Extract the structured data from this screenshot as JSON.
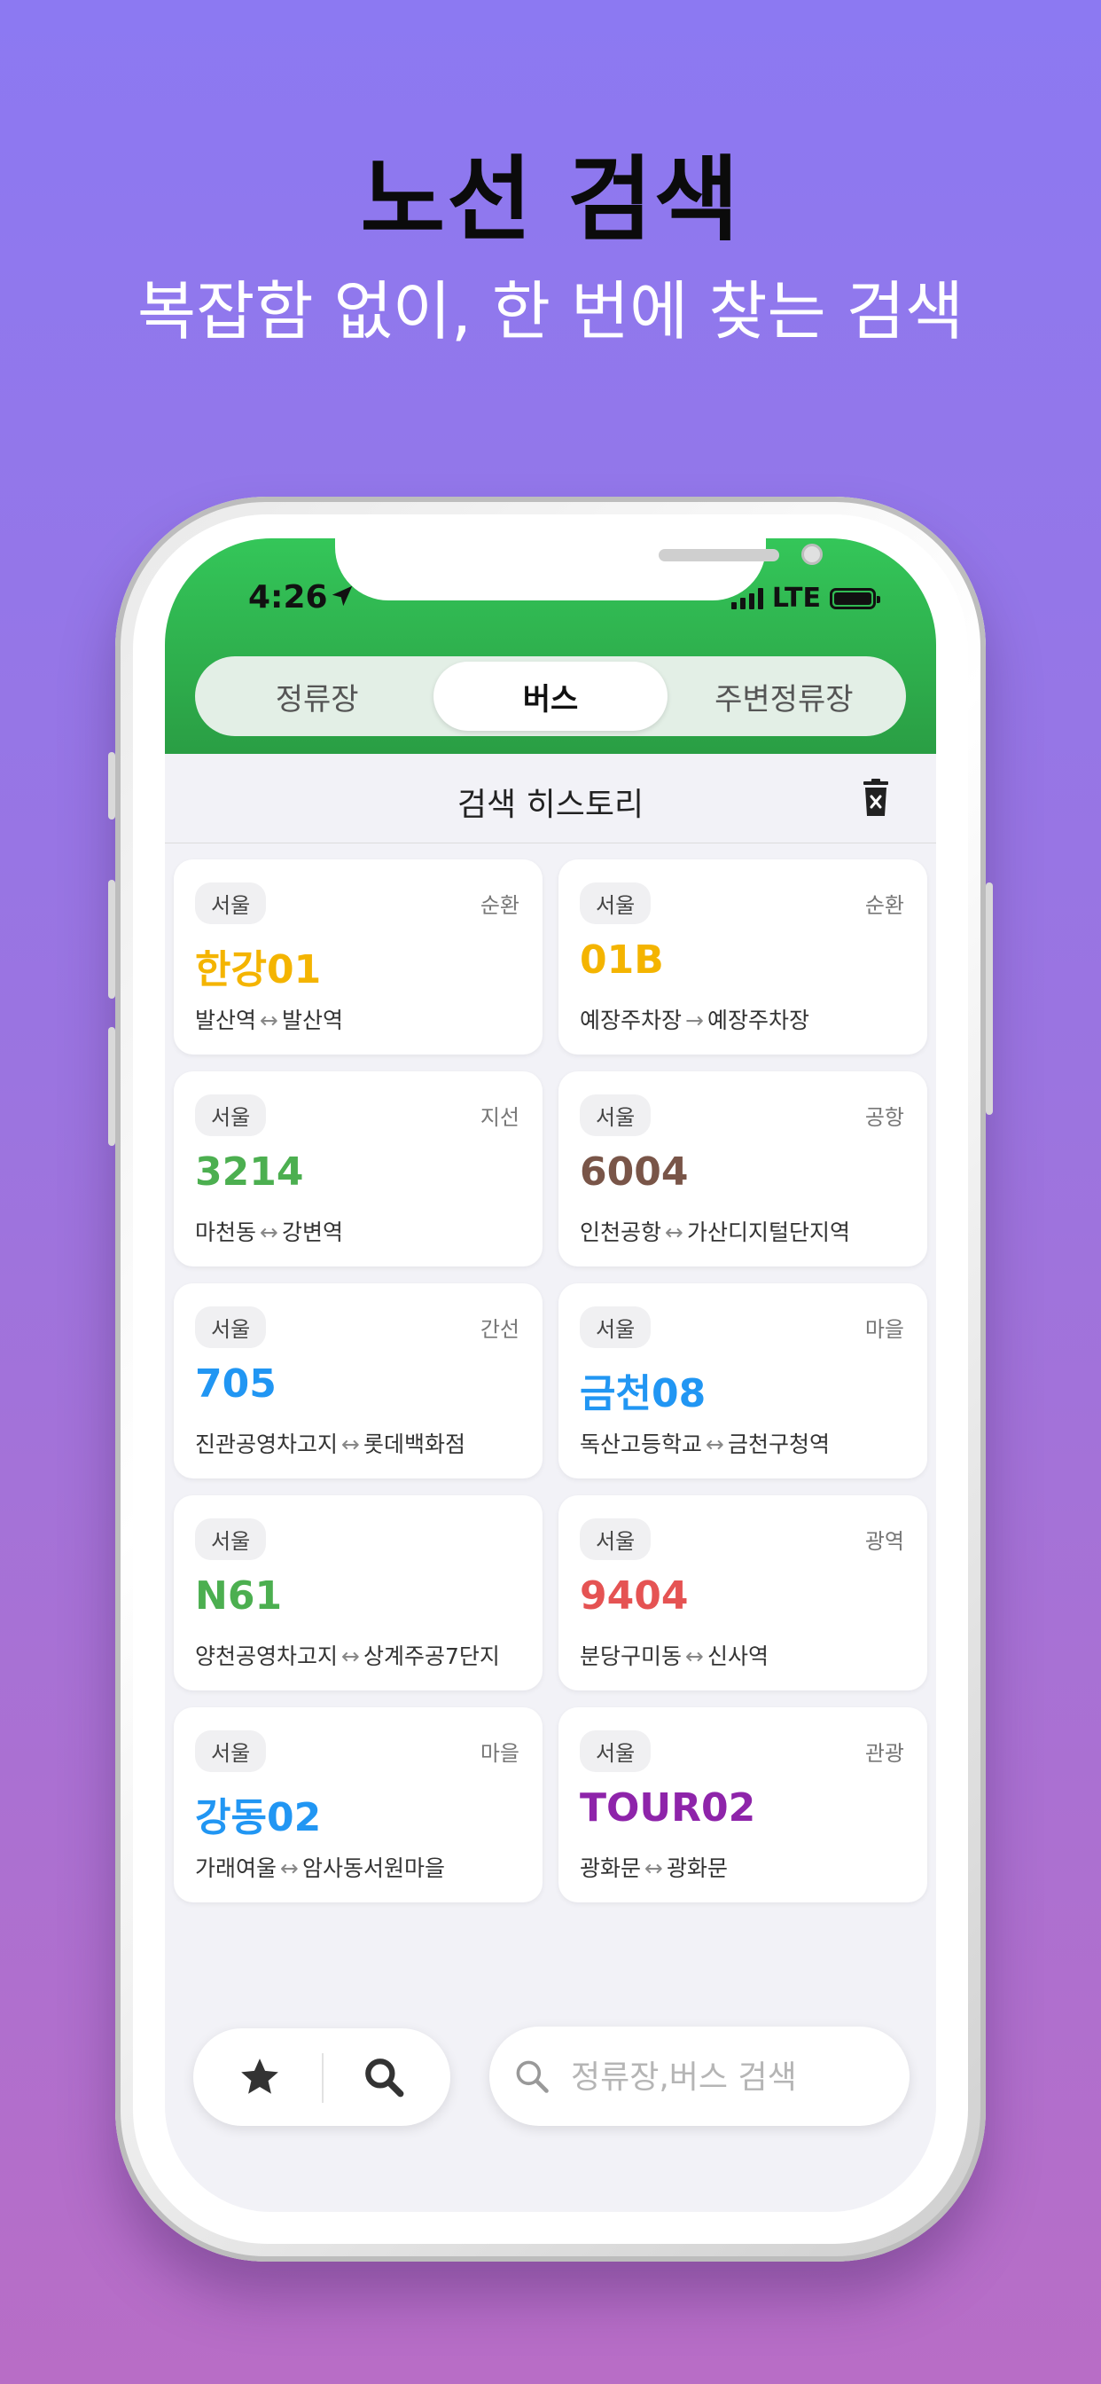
{
  "headline": "노선 검색",
  "subheadline": "복잡함 없이, 한 번에 찾는 검색",
  "status_bar": {
    "time": "4:26",
    "network": "LTE"
  },
  "tabs": [
    {
      "label": "정류장",
      "active": false
    },
    {
      "label": "버스",
      "active": true
    },
    {
      "label": "주변정류장",
      "active": false
    }
  ],
  "history": {
    "title": "검색 히스토리",
    "clear_icon": "trash-icon"
  },
  "routes": [
    {
      "region": "서울",
      "type": "순환",
      "number": "한강01",
      "color": "#f4b400",
      "from": "발산역",
      "arrow": "↔",
      "to": "발산역"
    },
    {
      "region": "서울",
      "type": "순환",
      "number": "01B",
      "color": "#f4b400",
      "from": "예장주차장",
      "arrow": "→",
      "to": "예장주차장"
    },
    {
      "region": "서울",
      "type": "지선",
      "number": "3214",
      "color": "#4caf50",
      "from": "마천동",
      "arrow": "↔",
      "to": "강변역"
    },
    {
      "region": "서울",
      "type": "공항",
      "number": "6004",
      "color": "#795548",
      "from": "인천공항",
      "arrow": "↔",
      "to": "가산디지털단지역"
    },
    {
      "region": "서울",
      "type": "간선",
      "number": "705",
      "color": "#2196f3",
      "from": "진관공영차고지",
      "arrow": "↔",
      "to": "롯데백화점"
    },
    {
      "region": "서울",
      "type": "마을",
      "number": "금천08",
      "color": "#2196f3",
      "from": "독산고등학교",
      "arrow": "↔",
      "to": "금천구청역"
    },
    {
      "region": "서울",
      "type": "",
      "number": "N61",
      "color": "#4caf50",
      "from": "양천공영차고지",
      "arrow": "↔",
      "to": "상계주공7단지"
    },
    {
      "region": "서울",
      "type": "광역",
      "number": "9404",
      "color": "#e55353",
      "from": "분당구미동",
      "arrow": "↔",
      "to": "신사역"
    },
    {
      "region": "서울",
      "type": "마을",
      "number": "강동02",
      "color": "#2196f3",
      "from": "가래여울",
      "arrow": "↔",
      "to": "암사동서원마을"
    },
    {
      "region": "서울",
      "type": "관광",
      "number": "TOUR02",
      "color": "#8e24aa",
      "from": "광화문",
      "arrow": "↔",
      "to": "광화문"
    }
  ],
  "bottom": {
    "favorite_icon": "star-icon",
    "search_icon": "search-icon",
    "search_placeholder": "정류장,버스 검색"
  }
}
